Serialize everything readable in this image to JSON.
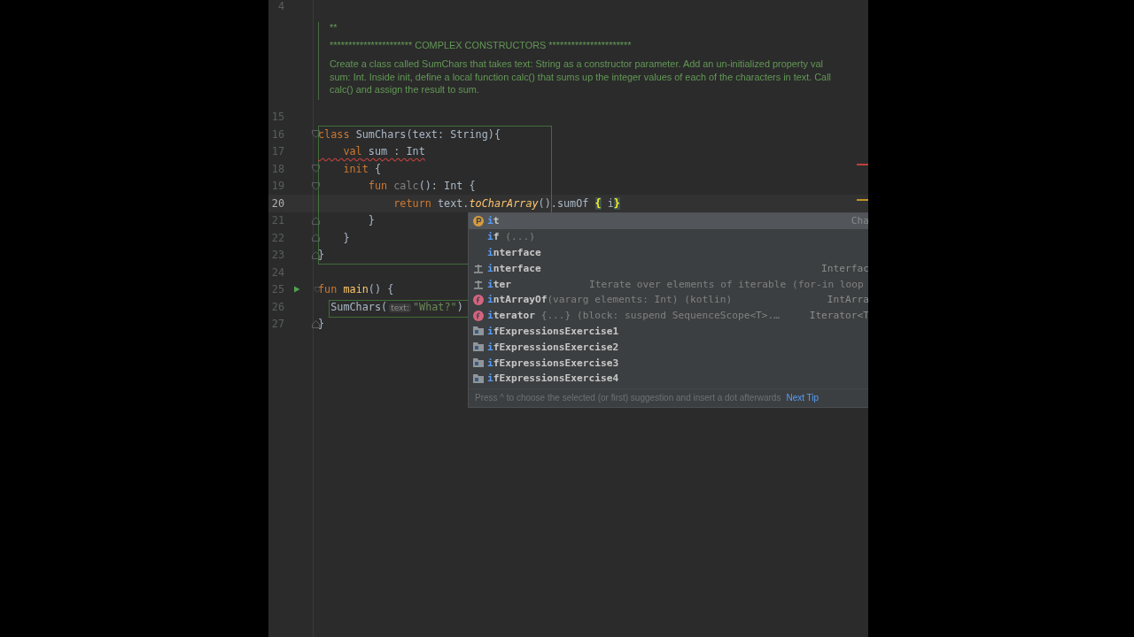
{
  "editor": {
    "top_line": "4",
    "doc": {
      "marker": "**",
      "heading": "********************** COMPLEX CONSTRUCTORS **********************",
      "body": "Create a class called SumChars that takes text: String as a constructor parameter. Add an un-initialized property val sum: Int. Inside init, define a local function calc() that sums up the integer values of each of the characters in text. Call calc() and assign the result to sum."
    },
    "lines": [
      {
        "number": "15",
        "current": false,
        "kind": "plain"
      },
      {
        "number": "16",
        "current": false,
        "kind": "fold",
        "tokens": [
          {
            "text": "class ",
            "kind": "kw"
          },
          {
            "text": "SumChars(text: String){",
            "kind": "plain"
          }
        ]
      },
      {
        "number": "17",
        "current": false,
        "kind": "plain",
        "error": true,
        "tokens": [
          {
            "text": "    val",
            "kind": "kw"
          },
          {
            "text": " sum : Int",
            "kind": "plain"
          }
        ]
      },
      {
        "number": "18",
        "current": false,
        "kind": "fold",
        "tokens": [
          {
            "text": "    init",
            "kind": "kw"
          },
          {
            "text": " {",
            "kind": "plain"
          }
        ]
      },
      {
        "number": "19",
        "current": false,
        "kind": "fold",
        "tokens": [
          {
            "text": "        fun ",
            "kind": "kw"
          },
          {
            "text": "calc",
            "kind": "unused"
          },
          {
            "text": "(): Int {",
            "kind": "plain"
          }
        ]
      },
      {
        "number": "20",
        "current": true,
        "kind": "plain",
        "tokens": [
          {
            "text": "            return ",
            "kind": "kw"
          },
          {
            "text": "text.",
            "kind": "plain"
          },
          {
            "text": "toCharArray",
            "kind": "call"
          },
          {
            "text": "().sumOf ",
            "kind": "plain"
          },
          {
            "text": "{",
            "kind": "brace"
          },
          {
            "text": " i",
            "kind": "plain"
          },
          {
            "text": "}",
            "kind": "brace"
          }
        ]
      },
      {
        "number": "21",
        "current": false,
        "kind": "end",
        "tokens": [
          {
            "text": "        }",
            "kind": "plain"
          }
        ]
      },
      {
        "number": "22",
        "current": false,
        "kind": "end",
        "tokens": [
          {
            "text": "    }",
            "kind": "plain"
          }
        ]
      },
      {
        "number": "23",
        "current": false,
        "kind": "end",
        "tokens": [
          {
            "text": "}",
            "kind": "plain"
          }
        ]
      },
      {
        "number": "24",
        "current": false,
        "kind": "plain"
      },
      {
        "number": "25",
        "current": false,
        "kind": "run",
        "tokens": [
          {
            "text": "fun ",
            "kind": "kw"
          },
          {
            "text": "main",
            "kind": "decl"
          },
          {
            "text": "() {",
            "kind": "plain"
          }
        ]
      },
      {
        "number": "26",
        "current": false,
        "kind": "plain",
        "tokens": [
          {
            "text": "  SumChars(",
            "kind": "plain"
          },
          {
            "text": "text:",
            "kind": "hint"
          },
          {
            "text": "\"What?\"",
            "kind": "str"
          },
          {
            "text": ")",
            "kind": "plain"
          }
        ]
      },
      {
        "number": "27",
        "current": false,
        "kind": "end",
        "tokens": [
          {
            "text": "}",
            "kind": "plain"
          }
        ]
      }
    ]
  },
  "completion": {
    "items": [
      {
        "kind": "property",
        "match": "i",
        "rest": "t",
        "type": "Cha",
        "selected": true
      },
      {
        "kind": "keyword",
        "match": "i",
        "rest": "f",
        "detail": " (...)",
        "selected": false
      },
      {
        "kind": "keyword",
        "match": "i",
        "rest": "nterface",
        "selected": false
      },
      {
        "kind": "template",
        "match": "i",
        "rest": "nterface",
        "type": "Interfac",
        "selected": false
      },
      {
        "kind": "template",
        "match": "i",
        "rest": "ter",
        "detail": "Iterate over elements of iterable (for-in loop",
        "selected": false
      },
      {
        "kind": "function",
        "match": "i",
        "rest": "ntArrayOf",
        "detail": "(vararg elements: Int) (kotlin)",
        "type": "IntArra",
        "selected": false
      },
      {
        "kind": "function",
        "match": "i",
        "rest": "terator",
        "detail": " {...} (block: suspend SequenceScope<T>.…",
        "type": "Iterator<T",
        "selected": false
      },
      {
        "kind": "folder",
        "match": "i",
        "rest": "fExpressionsExercise1",
        "selected": false
      },
      {
        "kind": "folder",
        "match": "i",
        "rest": "fExpressionsExercise2",
        "selected": false
      },
      {
        "kind": "folder",
        "match": "i",
        "rest": "fExpressionsExercise3",
        "selected": false
      },
      {
        "kind": "folder",
        "match": "i",
        "rest": "fExpressionsExercise4",
        "selected": false
      }
    ],
    "hint": "Press ^ to choose the selected (or first) suggestion and insert a dot afterwards",
    "next_tip": "Next Tip"
  }
}
